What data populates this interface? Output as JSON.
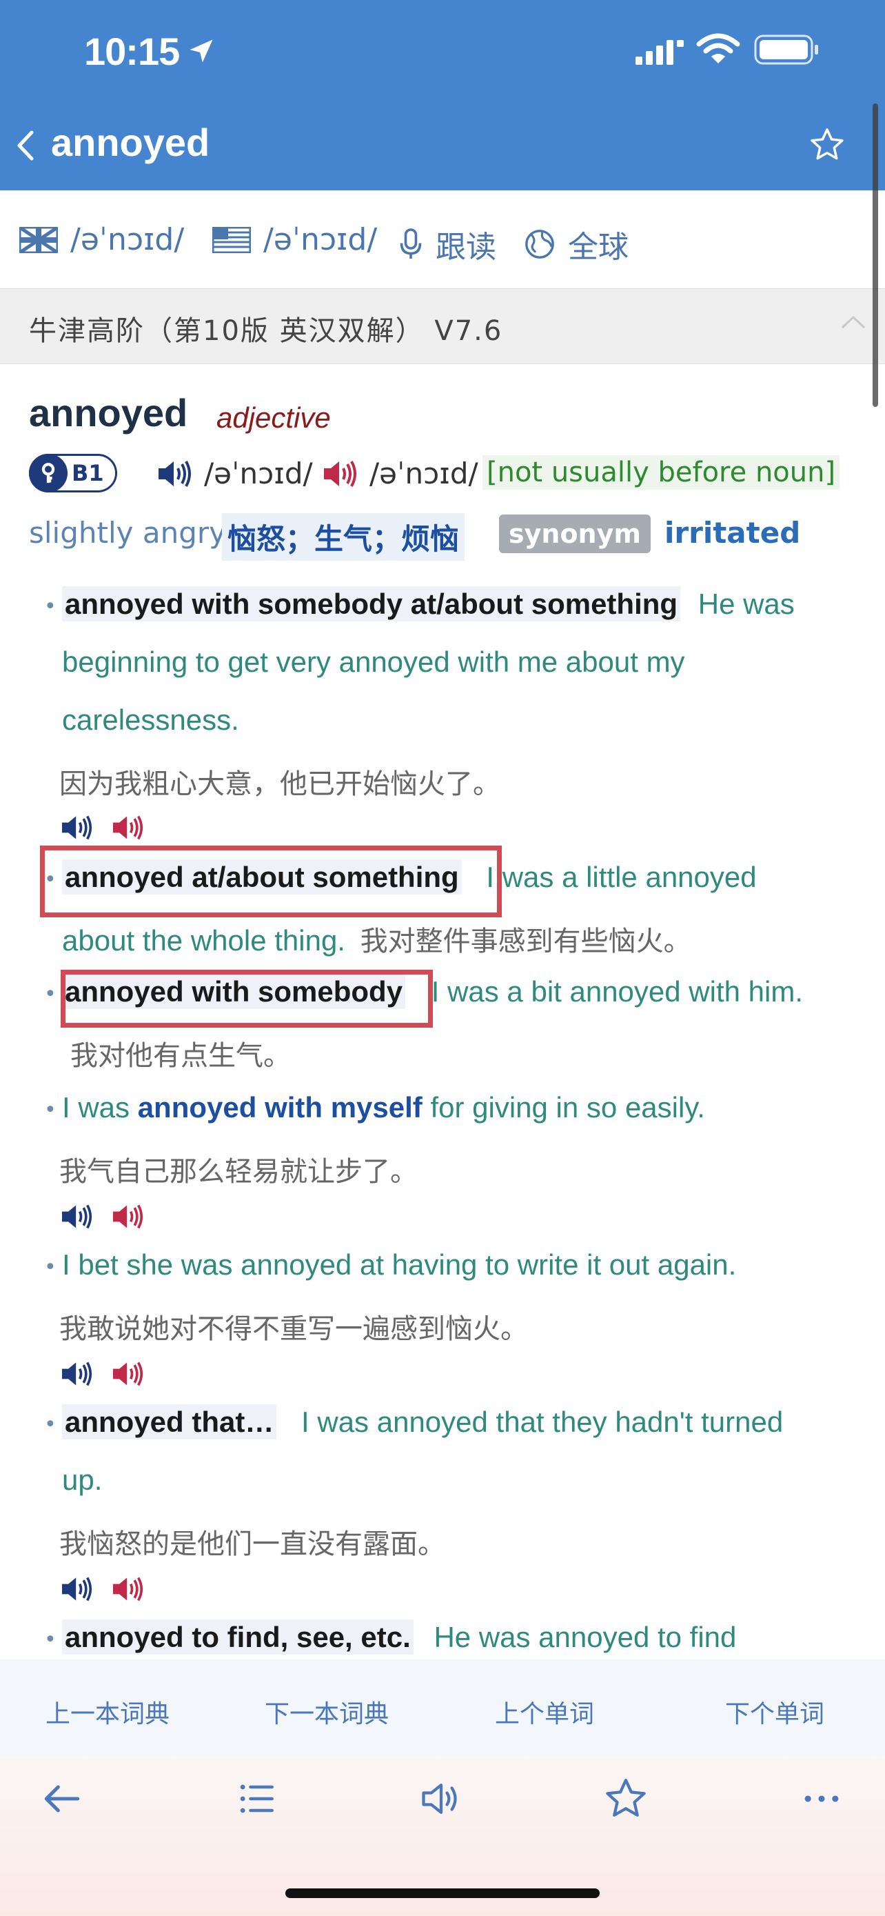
{
  "status": {
    "time": "10:15"
  },
  "nav": {
    "title": "annoyed"
  },
  "pron_bar": {
    "uk_ipa": "/əˈnɔɪd/",
    "us_ipa": "/əˈnɔɪd/",
    "follow_read": "跟读",
    "global": "全球"
  },
  "dict": {
    "name": "牛津高阶（第10版 英汉双解） V7.6"
  },
  "entry": {
    "headword": "annoyed",
    "pos": "adjective",
    "level": "B1",
    "uk_ipa": "/əˈnɔɪd/",
    "us_ipa": "/əˈnɔɪd/",
    "grammar": "[not usually before noun]",
    "definition_en": "slightly angry",
    "definition_zh": "恼怒；生气；烦恼",
    "synonym_label": "synonym",
    "synonym": "irritated"
  },
  "examples": {
    "e1": {
      "pattern": "annoyed with somebody at/about something",
      "line1": "He was",
      "line2": "beginning to get very annoyed with me about my",
      "line3": "carelessness.",
      "zh": "因为我粗心大意，他已开始恼火了。"
    },
    "e2": {
      "pattern": "annoyed at/about something",
      "line1": "I was a little annoyed",
      "line2": "about the whole thing.",
      "zh": "我对整件事感到有些恼火。"
    },
    "e3": {
      "pattern": "annoyed with somebody",
      "line1": "I was a bit annoyed with him.",
      "zh": "我对他有点生气。"
    },
    "e4": {
      "pre": "I was",
      "bold": "annoyed with myself",
      "post": "for giving in so easily.",
      "zh": "我气自己那么轻易就让步了。"
    },
    "e5": {
      "text": "I bet she was annoyed at having to write it out again.",
      "zh": "我敢说她对不得不重写一遍感到恼火。"
    },
    "e6": {
      "pattern": "annoyed that…",
      "line1": "I was annoyed that they hadn't turned",
      "line2": "up.",
      "zh": "我恼怒的是他们一直没有露面。"
    },
    "e7": {
      "pattern": "annoyed to find, see, etc.",
      "line1": "He was annoyed to find"
    }
  },
  "bottom_nav": {
    "prev_dict": "上一本词典",
    "next_dict": "下一本词典",
    "prev_word": "上个单词",
    "next_word": "下个单词"
  },
  "colors": {
    "header_blue": "#4584cf",
    "highlight_red": "#d14b55",
    "example_teal": "#2f8a7e"
  }
}
